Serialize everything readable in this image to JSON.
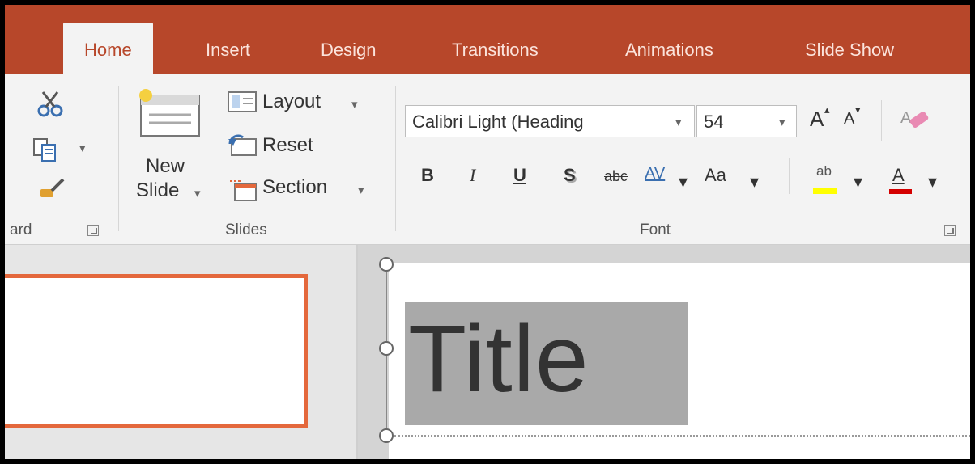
{
  "tabs": [
    {
      "label": "Home",
      "active": true
    },
    {
      "label": "Insert",
      "active": false
    },
    {
      "label": "Design",
      "active": false
    },
    {
      "label": "Transitions",
      "active": false
    },
    {
      "label": "Animations",
      "active": false
    },
    {
      "label": "Slide Show",
      "active": false
    }
  ],
  "clipboard": {
    "group_label": "ard",
    "icons": [
      "cut-icon",
      "copy-icon",
      "format-painter-icon"
    ]
  },
  "slides_group": {
    "new_slide_line1": "New",
    "new_slide_line2": "Slide",
    "layout_label": "Layout",
    "reset_label": "Reset",
    "section_label": "Section",
    "group_label": "Slides",
    "dropdown_glyph": "▾"
  },
  "font_group": {
    "font_name": "Calibri Light (Heading",
    "font_size": "54",
    "grow_label": "A",
    "shrink_label": "A",
    "bold": "B",
    "italic": "I",
    "underline": "U",
    "shadow": "S",
    "strikethrough": "abc",
    "spacing": "AV",
    "change_case": "Aa",
    "highlight": "ab",
    "font_color": "A",
    "group_label": "Font"
  },
  "slide": {
    "title_text": "Title"
  },
  "colors": {
    "accent": "#b7472a",
    "thumb_border": "#e4683c",
    "highlight_yellow": "#ffff00",
    "font_color_red": "#d40000"
  }
}
